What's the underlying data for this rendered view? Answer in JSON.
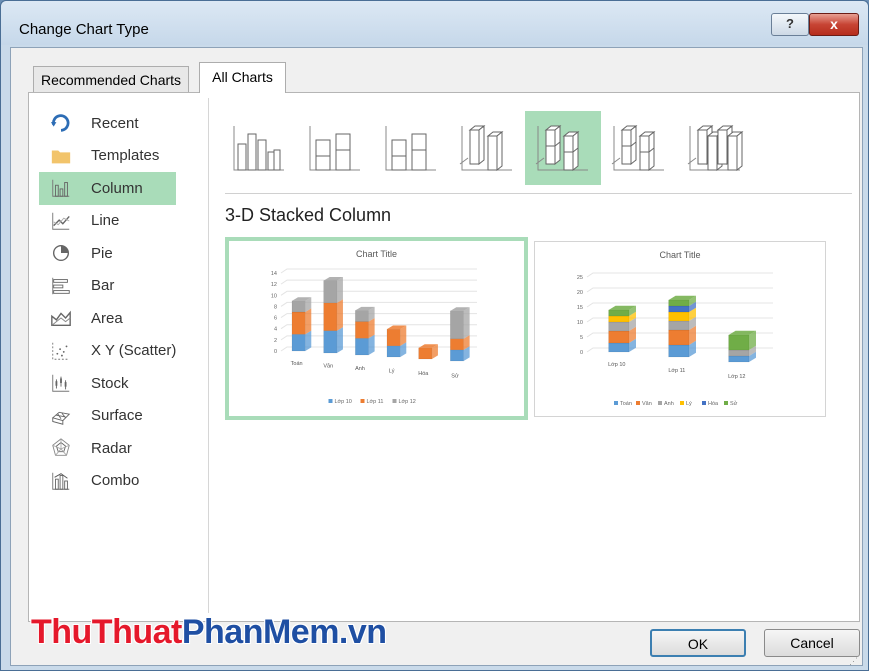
{
  "window": {
    "title": "Change Chart Type",
    "help_label": "?",
    "close_label": "x"
  },
  "tabs": [
    {
      "label": "Recommended Charts"
    },
    {
      "label": "All Charts"
    }
  ],
  "sidebar": {
    "items": [
      {
        "label": "Recent",
        "icon": "recent-icon"
      },
      {
        "label": "Templates",
        "icon": "folder-icon"
      },
      {
        "label": "Column",
        "icon": "column-chart-icon",
        "selected": true
      },
      {
        "label": "Line",
        "icon": "line-chart-icon"
      },
      {
        "label": "Pie",
        "icon": "pie-chart-icon"
      },
      {
        "label": "Bar",
        "icon": "bar-chart-icon"
      },
      {
        "label": "Area",
        "icon": "area-chart-icon"
      },
      {
        "label": "X Y (Scatter)",
        "icon": "scatter-chart-icon"
      },
      {
        "label": "Stock",
        "icon": "stock-chart-icon"
      },
      {
        "label": "Surface",
        "icon": "surface-chart-icon"
      },
      {
        "label": "Radar",
        "icon": "radar-chart-icon"
      },
      {
        "label": "Combo",
        "icon": "combo-chart-icon"
      }
    ]
  },
  "subtypes": {
    "selected_index": 4,
    "icons": [
      "clustered-column-icon",
      "stacked-column-icon",
      "100-stacked-column-icon",
      "3d-clustered-column-icon",
      "3d-stacked-column-icon",
      "3d-100-stacked-column-icon",
      "3d-column-icon"
    ]
  },
  "selected_type_name": "3-D Stacked Column",
  "previews": [
    {
      "chart_data": {
        "type": "bar",
        "stacked": true,
        "title": "Chart Title",
        "categories": [
          "Toán",
          "Văn",
          "Anh",
          "Lý",
          "Hóa",
          "Sử"
        ],
        "series": [
          {
            "name": "Lớp 10",
            "values": [
              3,
              4,
              3,
              2,
              0,
              2
            ]
          },
          {
            "name": "Lớp 11",
            "values": [
              4,
              5,
              3,
              3,
              2,
              2
            ]
          },
          {
            "name": "Lớp 12",
            "values": [
              2,
              4,
              2,
              0,
              0,
              5
            ]
          }
        ],
        "yticks": [
          "0",
          "2",
          "4",
          "6",
          "8",
          "10",
          "12",
          "14"
        ],
        "ylim": [
          0,
          14
        ],
        "colors": [
          "#5b9bd5",
          "#ed7d31",
          "#a5a5a5"
        ],
        "legend_position": "bottom",
        "selected": true
      }
    },
    {
      "chart_data": {
        "type": "bar",
        "stacked": true,
        "title": "Chart Title",
        "categories": [
          "Lớp 10",
          "Lớp 11",
          "Lớp 12"
        ],
        "series": [
          {
            "name": "Toán",
            "values": [
              3,
              4,
              2
            ]
          },
          {
            "name": "Văn",
            "values": [
              4,
              5,
              0
            ]
          },
          {
            "name": "Anh",
            "values": [
              3,
              3,
              2
            ]
          },
          {
            "name": "Lý",
            "values": [
              2,
              3,
              0
            ]
          },
          {
            "name": "Hóa",
            "values": [
              0,
              2,
              0
            ]
          },
          {
            "name": "Sử",
            "values": [
              2,
              2,
              5
            ]
          }
        ],
        "yticks": [
          "0",
          "5",
          "10",
          "15",
          "20",
          "25"
        ],
        "ylim": [
          0,
          25
        ],
        "colors": [
          "#5b9bd5",
          "#ed7d31",
          "#a5a5a5",
          "#ffc000",
          "#4472c4",
          "#70ad47"
        ],
        "legend_position": "bottom",
        "selected": false
      }
    }
  ],
  "buttons": {
    "ok_label": "OK",
    "cancel_label": "Cancel"
  },
  "watermark": {
    "part1": "ThuThuat",
    "part2": "PhanMem.vn"
  },
  "colors": {
    "selection": "#a9dcb9",
    "title_bar": "#c6d8ea",
    "close": "#c74434"
  }
}
